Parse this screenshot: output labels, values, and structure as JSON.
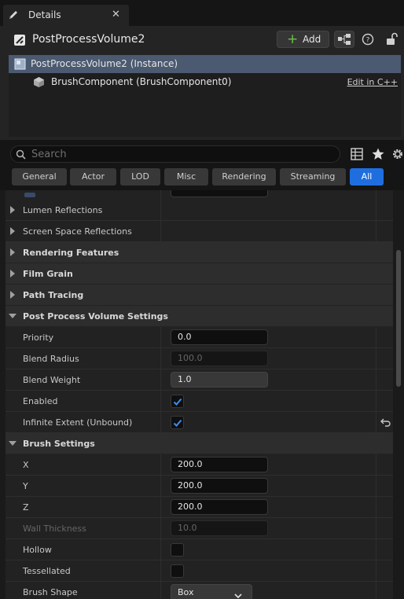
{
  "tab": {
    "label": "Details",
    "close": "✕"
  },
  "header": {
    "object_title": "PostProcessVolume2",
    "add_label": "Add"
  },
  "components": {
    "instance_label": "PostProcessVolume2 (Instance)",
    "brush_label": "BrushComponent (BrushComponent0)",
    "edit_link": "Edit in C++"
  },
  "search": {
    "placeholder": "Search",
    "value": ""
  },
  "filters": [
    "General",
    "Actor",
    "LOD",
    "Misc",
    "Rendering",
    "Streaming",
    "All"
  ],
  "active_filter": "All",
  "categories": {
    "lumen_reflections": "Lumen Reflections",
    "screen_space_reflections": "Screen Space Reflections",
    "rendering_features": "Rendering Features",
    "film_grain": "Film Grain",
    "path_tracing": "Path Tracing",
    "post_process_volume_settings": "Post Process Volume Settings",
    "brush_settings": "Brush Settings"
  },
  "ppv": {
    "priority_label": "Priority",
    "priority_value": "0.0",
    "blend_radius_label": "Blend Radius",
    "blend_radius_value": "100.0",
    "blend_weight_label": "Blend Weight",
    "blend_weight_value": "1.0",
    "enabled_label": "Enabled",
    "enabled_checked": true,
    "infinite_label": "Infinite Extent (Unbound)",
    "infinite_checked": true
  },
  "brush": {
    "x_label": "X",
    "x_value": "200.0",
    "y_label": "Y",
    "y_value": "200.0",
    "z_label": "Z",
    "z_value": "200.0",
    "wall_label": "Wall Thickness",
    "wall_value": "10.0",
    "hollow_label": "Hollow",
    "hollow_checked": false,
    "tessellated_label": "Tessellated",
    "tessellated_checked": false,
    "shape_label": "Brush Shape",
    "shape_value": "Box"
  },
  "colors": {
    "accent": "#1f6ee0",
    "selected_row": "#4b5a70",
    "add_plus": "#6fc24a"
  }
}
